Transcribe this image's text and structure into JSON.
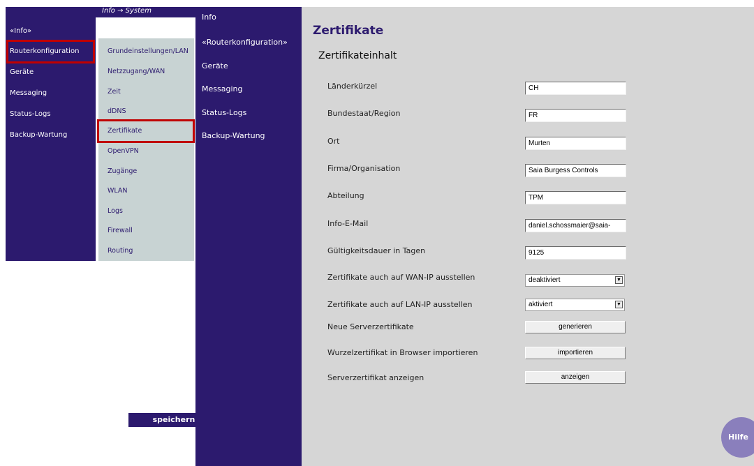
{
  "breadcrumb": "Info → System",
  "nav_primary": [
    "«Info»",
    "Routerkonfiguration",
    "Geräte",
    "Messaging",
    "Status-Logs",
    "Backup-Wartung"
  ],
  "nav_sub": [
    "Grundeinstellungen/LAN",
    "Netzzugang/WAN",
    "Zeit",
    "dDNS",
    "Zertifikate",
    "OpenVPN",
    "Zugänge",
    "WLAN",
    "Logs",
    "Firewall",
    "Routing"
  ],
  "nav_main": [
    "Info",
    "«Routerkonfiguration»",
    "Geräte",
    "Messaging",
    "Status-Logs",
    "Backup-Wartung"
  ],
  "page_title": "Zertifikate",
  "section_title": "Zertifikateinhalt",
  "fields": [
    {
      "label": "Länderkürzel",
      "value": "CH"
    },
    {
      "label": "Bundestaat/Region",
      "value": "FR"
    },
    {
      "label": "Ort",
      "value": "Murten"
    },
    {
      "label": "Firma/Organisation",
      "value": "Saia Burgess Controls"
    },
    {
      "label": "Abteilung",
      "value": "TPM"
    },
    {
      "label": "Info-E-Mail",
      "value": "daniel.schossmaier@saia-"
    },
    {
      "label": "Gültigkeitsdauer in Tagen",
      "value": "9125"
    }
  ],
  "selects": [
    {
      "label": "Zertifikate auch auf WAN-IP ausstellen",
      "value": "deaktiviert"
    },
    {
      "label": "Zertifikate auch auf LAN-IP ausstellen",
      "value": "aktiviert"
    }
  ],
  "actions": [
    {
      "label": "Neue Serverzertifikate",
      "button": "generieren"
    },
    {
      "label": "Wurzelzertifikat in Browser importieren",
      "button": "importieren"
    },
    {
      "label": "Serverzertifikat anzeigen",
      "button": "anzeigen"
    }
  ],
  "save_label": "speichern",
  "help_label": "Hilfe",
  "colors": {
    "nav": "#2c1a6e",
    "subnav": "#c8d3d3",
    "content": "#d6d6d6",
    "highlight": "#c00000"
  }
}
